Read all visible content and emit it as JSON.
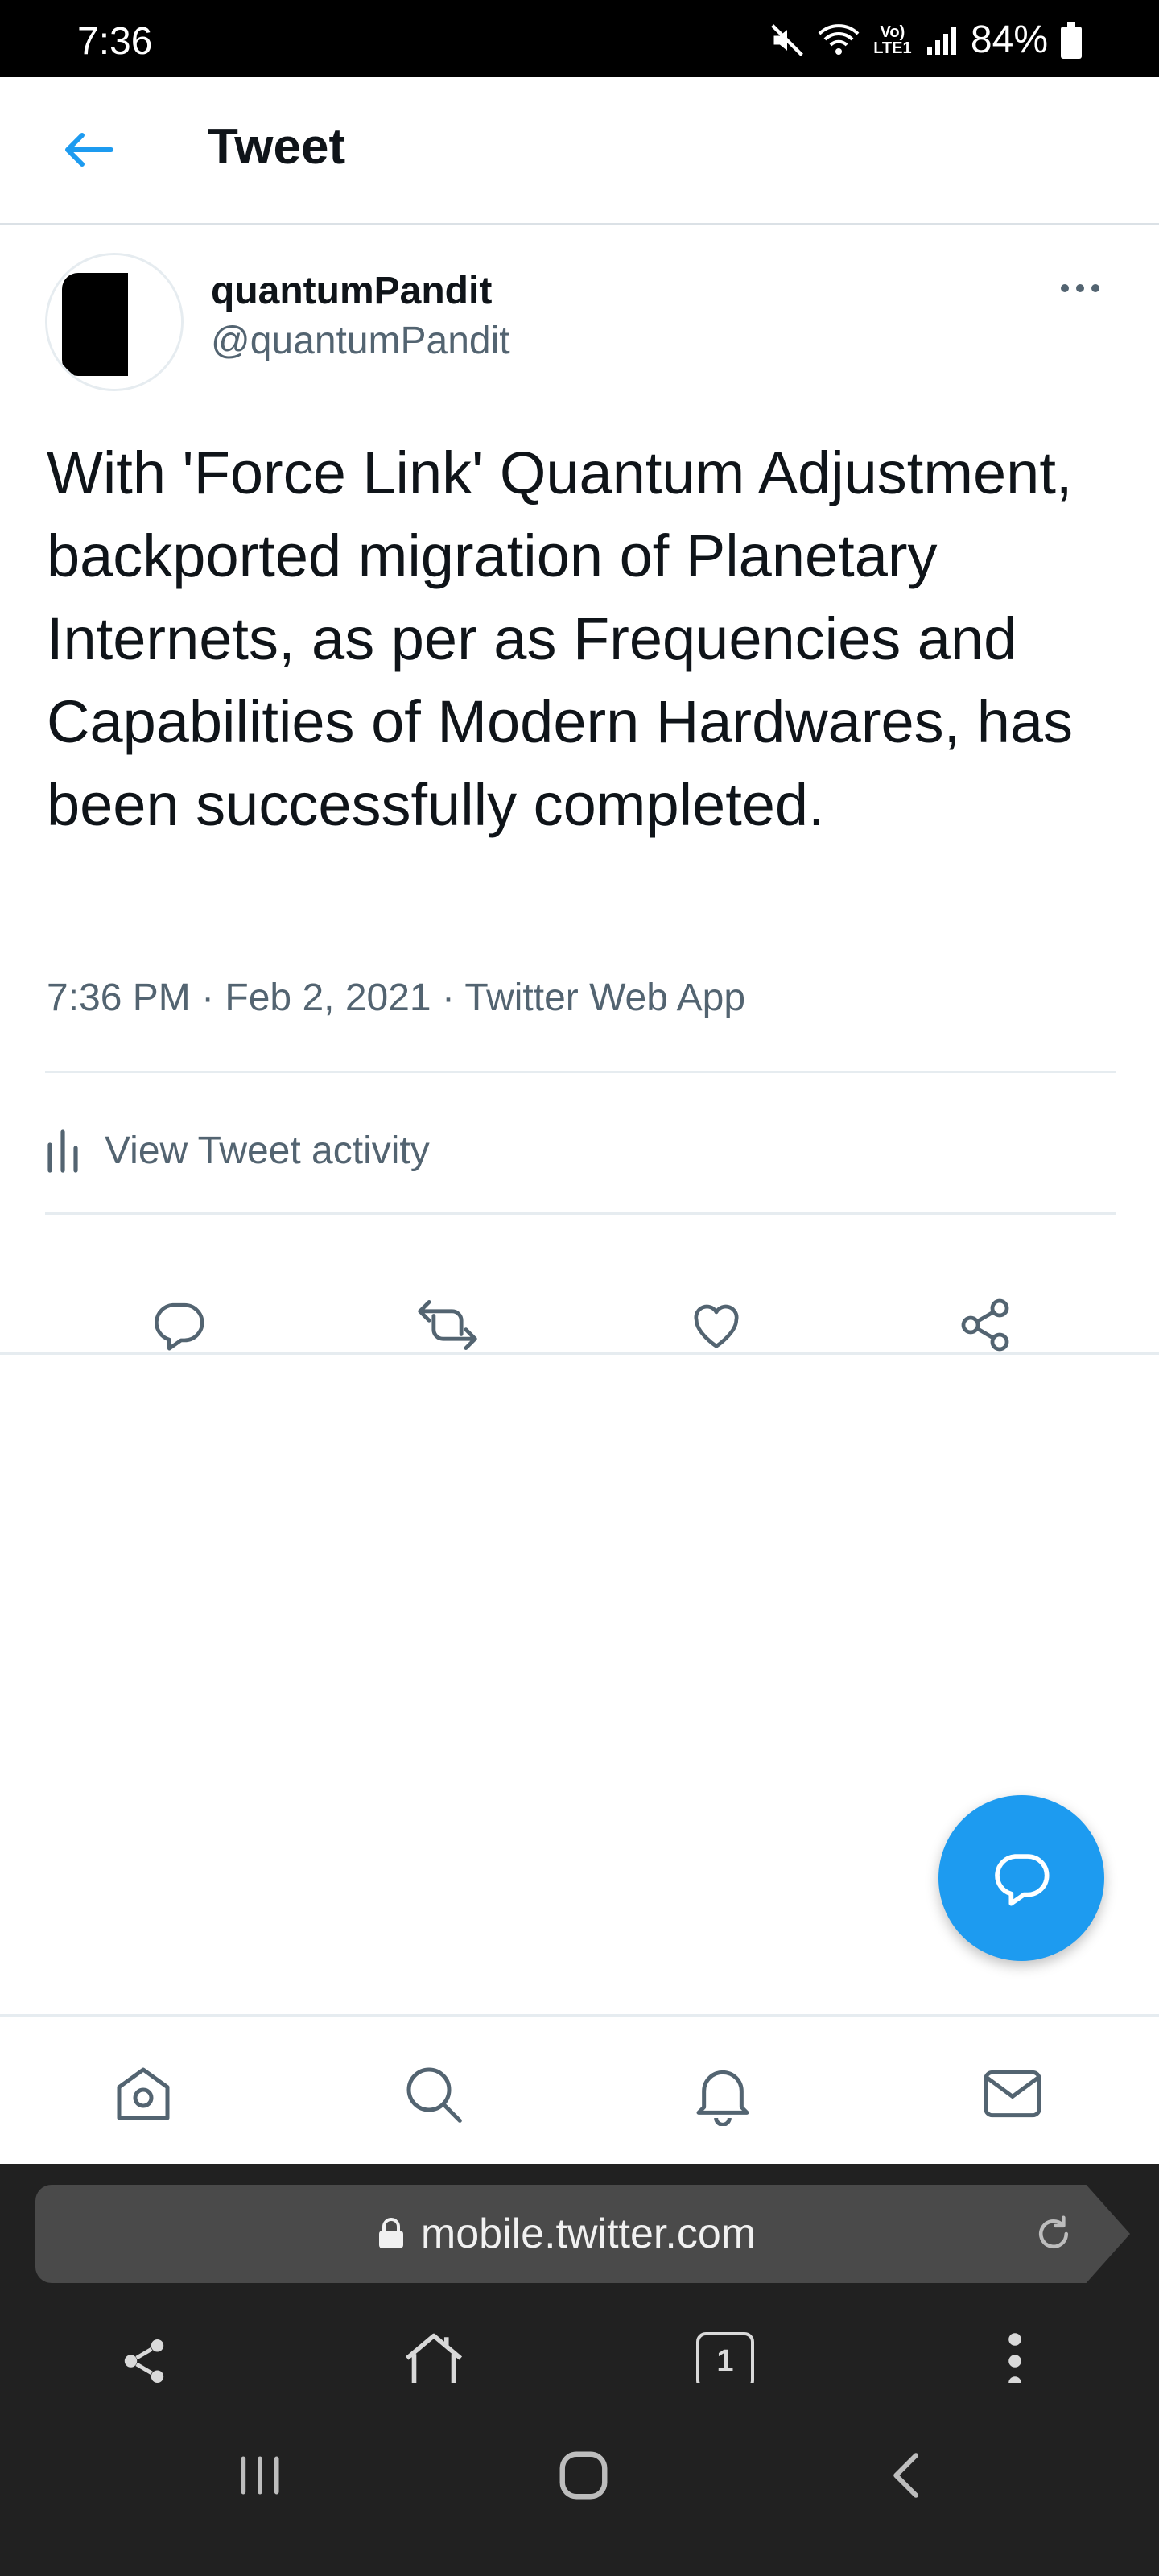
{
  "status_bar": {
    "time": "7:36",
    "network_label": "Vo) LTE1",
    "battery": "84%"
  },
  "header": {
    "title": "Tweet"
  },
  "tweet": {
    "author_name": "quantumPandit",
    "author_handle": "@quantumPandit",
    "text": "With 'Force Link' Quantum Adjustment, backported migration of Planetary Internets, as per as Frequencies and Capabilities of Modern Hardwares, has been successfully completed.",
    "meta": "7:36 PM · Feb 2, 2021 · Twitter Web App",
    "activity_label": "View Tweet activity"
  },
  "browser": {
    "url": "mobile.twitter.com",
    "tab_count": "1"
  },
  "colors": {
    "accent": "#1d9bf0",
    "secondary_text": "#536471",
    "status_bar": "#000000",
    "browser_bar": "#212121"
  },
  "icons": {
    "tweet_actions": [
      "reply-icon",
      "retweet-icon",
      "like-icon",
      "share-icon"
    ],
    "bottom_nav": [
      "home-icon",
      "search-icon",
      "notifications-icon",
      "messages-icon"
    ],
    "browser": [
      "share-icon",
      "home-icon",
      "tabs-icon",
      "menu-icon"
    ],
    "system_nav": [
      "recents-icon",
      "home-icon",
      "back-icon"
    ]
  }
}
